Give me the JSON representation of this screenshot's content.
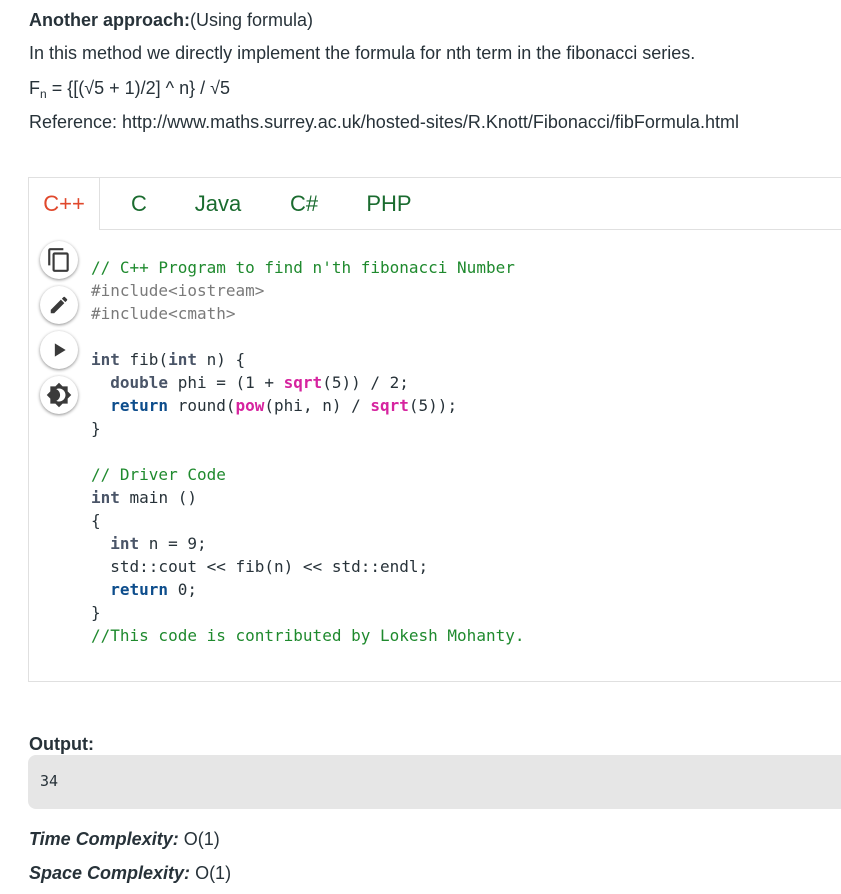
{
  "article": {
    "heading_bold": "Another approach:",
    "heading_rest": "(Using formula)",
    "description": "In this method we directly implement the formula for nth term in the fibonacci series.",
    "formula_prefix": "F",
    "formula_sub": "n",
    "formula_rest": " = {[(√5 + 1)/2] ^ n} / √5",
    "reference": "Reference: http://www.maths.surrey.ac.uk/hosted-sites/R.Knott/Fibonacci/fibFormula.html"
  },
  "tabs": [
    "C++",
    "C",
    "Java",
    "C#",
    "PHP"
  ],
  "active_tab": "C++",
  "toolbar": [
    {
      "name": "copy-icon"
    },
    {
      "name": "edit-icon"
    },
    {
      "name": "run-icon"
    },
    {
      "name": "theme-toggle-icon"
    }
  ],
  "code": {
    "comment_title": "// C++ Program to find n'th fibonacci Number",
    "include1": "#include<iostream>",
    "include2": "#include<cmath>",
    "comment_driver": "// Driver Code",
    "comment_credit": "//This code is contributed by Lokesh Mohanty."
  },
  "output": {
    "label": "Output:",
    "value": "34"
  },
  "complexity": {
    "time_label": "Time Complexity:",
    "time_value": " O(1)",
    "space_label": "Space Complexity:",
    "space_value": " O(1)"
  },
  "colors": {
    "active_tab": "#e0482c",
    "tab": "#1a6b2f",
    "comment": "#1f8a2e",
    "function": "#d6249f"
  }
}
